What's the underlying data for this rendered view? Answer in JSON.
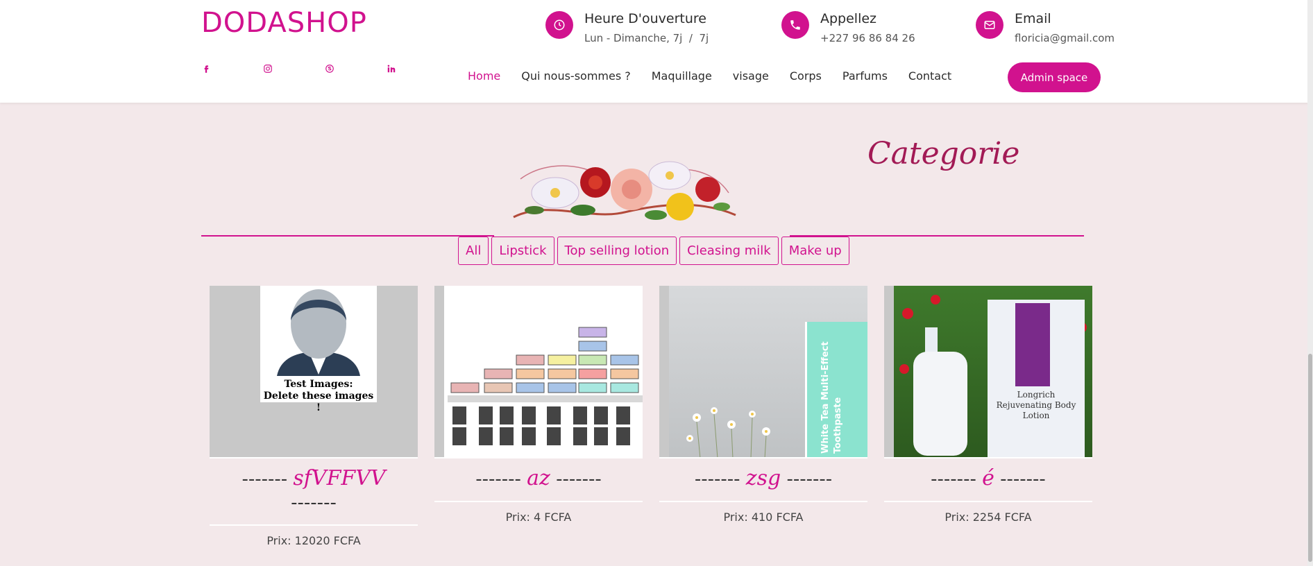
{
  "brand": "DODASHOP",
  "socials": [
    {
      "icon": "facebook-icon",
      "glyph": "f"
    },
    {
      "icon": "instagram-icon",
      "glyph": "◎"
    },
    {
      "icon": "skype-icon",
      "glyph": "ⓢ"
    },
    {
      "icon": "linkedin-icon",
      "glyph": "in"
    }
  ],
  "info": {
    "hours": {
      "title": "Heure D'ouverture",
      "sub": "Lun - Dimanche, 7j  /  7j",
      "icon": "clock-icon"
    },
    "phone": {
      "title": "Appellez",
      "sub": "+227 96 86 84 26",
      "icon": "phone-icon"
    },
    "email": {
      "title": "Email",
      "sub": "floricia@gmail.com",
      "icon": "mail-icon"
    }
  },
  "nav": [
    "Home",
    "Qui nous-sommes ?",
    "Maquillage",
    "visage",
    "Corps",
    "Parfums",
    "Contact"
  ],
  "admin_label": "Admin space",
  "section_title": "Categorie",
  "filters": [
    "All",
    "Lipstick",
    "Top selling lotion",
    "Cleasing milk",
    "Make up"
  ],
  "products": [
    {
      "name": "sfVFFVV",
      "dash": "-------",
      "price": "Prix: 12020 FCFA",
      "placeholder_text": "Test Images:\nDelete these images !"
    },
    {
      "name": "az",
      "dash": "-------",
      "price": "Prix: 4 FCFA"
    },
    {
      "name": "zsg",
      "dash": "-------",
      "price": "Prix: 410 FCFA",
      "tube_text": "White Tea Multi-Effect Toothpaste"
    },
    {
      "name": "é",
      "dash": "-------",
      "price": "Prix: 2254 FCFA",
      "label_text": "Longrich Rejuvenating Body Lotion"
    }
  ],
  "colors": {
    "accent": "#d1128e",
    "title": "#a21a55",
    "bg": "#f3e8ea"
  }
}
